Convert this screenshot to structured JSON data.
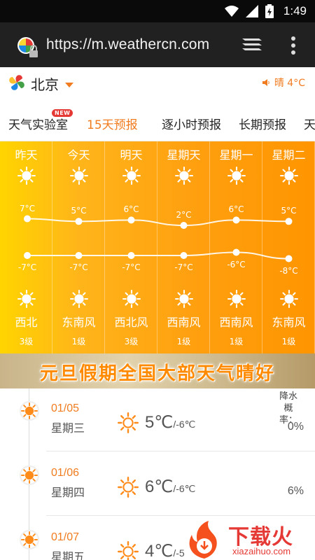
{
  "status": {
    "time": "1:49"
  },
  "browser": {
    "url": "https://m.weathercn.com"
  },
  "header": {
    "city": "北京",
    "current": "晴 4°C"
  },
  "tabs": [
    {
      "label": "天气实验室",
      "badge": "NEW"
    },
    {
      "label": "15天预报"
    },
    {
      "label": "逐小时预报"
    },
    {
      "label": "长期预报"
    },
    {
      "label": "天"
    }
  ],
  "forecast": [
    {
      "day": "昨天",
      "high": "7°C",
      "low": "-7°C",
      "wind": "西北",
      "level": "3级",
      "high_val": 7,
      "low_val": -7
    },
    {
      "day": "今天",
      "high": "5°C",
      "low": "-7°C",
      "wind": "东南风",
      "level": "1级",
      "high_val": 5,
      "low_val": -7
    },
    {
      "day": "明天",
      "high": "6°C",
      "low": "-7°C",
      "wind": "西北风",
      "level": "3级",
      "high_val": 6,
      "low_val": -7
    },
    {
      "day": "星期天",
      "high": "2°C",
      "low": "-7°C",
      "wind": "西南风",
      "level": "1级",
      "high_val": 2,
      "low_val": -7
    },
    {
      "day": "星期一",
      "high": "6°C",
      "low": "-6°C",
      "wind": "西南风",
      "level": "1级",
      "high_val": 6,
      "low_val": -6
    },
    {
      "day": "星期二",
      "high": "5°C",
      "low": "-8°C",
      "wind": "东南风",
      "level": "1级",
      "high_val": 5,
      "low_val": -8
    }
  ],
  "banner": {
    "text": "元旦假期全国大部天气晴好"
  },
  "list": {
    "rain_header": "降水概率：",
    "rows": [
      {
        "date": "01/05",
        "weekday": "星期三",
        "high": "5℃",
        "low": "/-6℃",
        "rain": "0%"
      },
      {
        "date": "01/06",
        "weekday": "星期四",
        "high": "6℃",
        "low": "/-6℃",
        "rain": "6%"
      },
      {
        "date": "01/07",
        "weekday": "星期五",
        "high": "4℃",
        "low": "/-5",
        "rain": ""
      }
    ]
  },
  "watermark": {
    "title": "下载火",
    "subtitle": "xiazaihuo.com"
  },
  "colors": {
    "accent": "#f07c1f",
    "sun": "#ff8c1a"
  }
}
